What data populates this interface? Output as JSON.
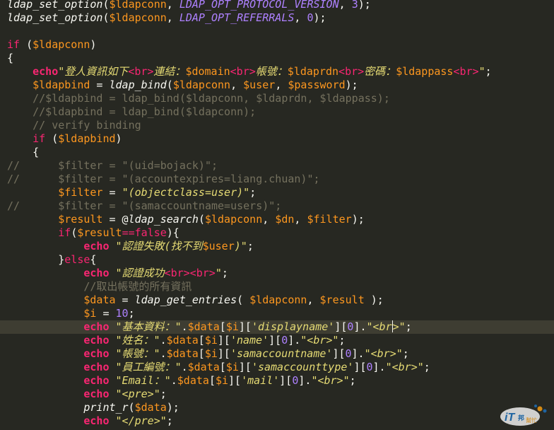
{
  "editor": {
    "highlight_line": 24,
    "cursor_line": 24,
    "lines": [
      [
        [
          "fn",
          "ldap_set_option"
        ],
        [
          "plain",
          "("
        ],
        [
          "var",
          "$ldapconn"
        ],
        [
          "plain",
          ", "
        ],
        [
          "const",
          "LDAP_OPT_PROTOCOL_VERSION"
        ],
        [
          "plain",
          ", "
        ],
        [
          "num",
          "3"
        ],
        [
          "plain",
          ");"
        ]
      ],
      [
        [
          "fn",
          "ldap_set_option"
        ],
        [
          "plain",
          "("
        ],
        [
          "var",
          "$ldapconn"
        ],
        [
          "plain",
          ", "
        ],
        [
          "const",
          "LDAP_OPT_REFERRALS"
        ],
        [
          "plain",
          ", "
        ],
        [
          "num",
          "0"
        ],
        [
          "plain",
          ");"
        ]
      ],
      [],
      [
        [
          "kw",
          "if"
        ],
        [
          "plain",
          " ("
        ],
        [
          "var",
          "$ldapconn"
        ],
        [
          "plain",
          ")"
        ]
      ],
      [
        [
          "plain",
          "{"
        ]
      ],
      [
        [
          "plain",
          "    "
        ],
        [
          "echo",
          "echo"
        ],
        [
          "str",
          "\"登人資訊如下"
        ],
        [
          "tag",
          "<br>"
        ],
        [
          "str",
          "連結："
        ],
        [
          "var",
          "$domain"
        ],
        [
          "tag",
          "<br>"
        ],
        [
          "str",
          "帳號："
        ],
        [
          "var",
          "$ldaprdn"
        ],
        [
          "tag",
          "<br>"
        ],
        [
          "str",
          "密碼："
        ],
        [
          "var",
          "$ldappass"
        ],
        [
          "tag",
          "<br>"
        ],
        [
          "str",
          "\""
        ],
        [
          "plain",
          ";"
        ]
      ],
      [
        [
          "plain",
          "    "
        ],
        [
          "var",
          "$ldapbind"
        ],
        [
          "plain",
          " = "
        ],
        [
          "fn",
          "ldap_bind"
        ],
        [
          "plain",
          "("
        ],
        [
          "var",
          "$ldapconn"
        ],
        [
          "plain",
          ", "
        ],
        [
          "var",
          "$user"
        ],
        [
          "plain",
          ", "
        ],
        [
          "var",
          "$password"
        ],
        [
          "plain",
          ");"
        ]
      ],
      [
        [
          "cmt",
          "    //$ldapbind = ldap_bind($ldapconn, $ldaprdn, $ldappass);"
        ]
      ],
      [
        [
          "cmt",
          "    //$ldapbind = ldap_bind($ldapconn);"
        ]
      ],
      [
        [
          "cmt",
          "    // verify binding"
        ]
      ],
      [
        [
          "plain",
          "    "
        ],
        [
          "kw",
          "if"
        ],
        [
          "plain",
          " ("
        ],
        [
          "var",
          "$ldapbind"
        ],
        [
          "plain",
          ")"
        ]
      ],
      [
        [
          "plain",
          "    {"
        ]
      ],
      [
        [
          "cmt",
          "//      $filter = \"(uid=bojack)\";"
        ]
      ],
      [
        [
          "cmt",
          "//      $filter = \"(accountexpires=liang.chuan)\";"
        ]
      ],
      [
        [
          "plain",
          "        "
        ],
        [
          "var",
          "$filter"
        ],
        [
          "plain",
          " = "
        ],
        [
          "str",
          "\"(objectclass=user)\""
        ],
        [
          "plain",
          ";"
        ]
      ],
      [
        [
          "cmt",
          "//      $filter = \"(samaccountname=users)\";"
        ]
      ],
      [
        [
          "plain",
          "        "
        ],
        [
          "var",
          "$result"
        ],
        [
          "plain",
          " = @"
        ],
        [
          "fn",
          "ldap_search"
        ],
        [
          "plain",
          "("
        ],
        [
          "var",
          "$ldapconn"
        ],
        [
          "plain",
          ", "
        ],
        [
          "var",
          "$dn"
        ],
        [
          "plain",
          ", "
        ],
        [
          "var",
          "$filter"
        ],
        [
          "plain",
          ");"
        ]
      ],
      [
        [
          "plain",
          "        "
        ],
        [
          "kw",
          "if"
        ],
        [
          "plain",
          "("
        ],
        [
          "var",
          "$result"
        ],
        [
          "kw",
          "=="
        ],
        [
          "kw",
          "false"
        ],
        [
          "plain",
          "){"
        ]
      ],
      [
        [
          "plain",
          "            "
        ],
        [
          "echo",
          "echo"
        ],
        [
          "plain",
          " "
        ],
        [
          "str",
          "\"認證失敗(找不到"
        ],
        [
          "var",
          "$user"
        ],
        [
          "str",
          ")\""
        ],
        [
          "plain",
          ";"
        ]
      ],
      [
        [
          "plain",
          "        }"
        ],
        [
          "kw",
          "else"
        ],
        [
          "plain",
          "{"
        ]
      ],
      [
        [
          "plain",
          "            "
        ],
        [
          "echo",
          "echo"
        ],
        [
          "plain",
          " "
        ],
        [
          "str",
          "\"認證成功"
        ],
        [
          "tag",
          "<br><br>"
        ],
        [
          "str",
          "\""
        ],
        [
          "plain",
          ";"
        ]
      ],
      [
        [
          "cmt",
          "            //取出帳號的所有資訊"
        ]
      ],
      [
        [
          "plain",
          "            "
        ],
        [
          "var",
          "$data"
        ],
        [
          "plain",
          " = "
        ],
        [
          "fn",
          "ldap_get_entries"
        ],
        [
          "plain",
          "( "
        ],
        [
          "var",
          "$ldapconn"
        ],
        [
          "plain",
          ", "
        ],
        [
          "var",
          "$result"
        ],
        [
          "plain",
          " );"
        ]
      ],
      [
        [
          "plain",
          "            "
        ],
        [
          "var",
          "$i"
        ],
        [
          "plain",
          " = "
        ],
        [
          "num",
          "10"
        ],
        [
          "plain",
          ";"
        ]
      ],
      [
        [
          "plain",
          "            "
        ],
        [
          "echo",
          "echo"
        ],
        [
          "plain",
          " "
        ],
        [
          "str",
          "\"基本資料：\""
        ],
        [
          "plain",
          "."
        ],
        [
          "var",
          "$data"
        ],
        [
          "plain",
          "["
        ],
        [
          "var",
          "$i"
        ],
        [
          "plain",
          "]["
        ],
        [
          "str",
          "'displayname'"
        ],
        [
          "plain",
          "]["
        ],
        [
          "num",
          "0"
        ],
        [
          "plain",
          "]."
        ],
        [
          "str",
          "\"<br"
        ],
        [
          "cursor",
          ""
        ],
        [
          "str",
          ">\""
        ],
        [
          "plain",
          ";"
        ]
      ],
      [
        [
          "plain",
          "            "
        ],
        [
          "echo",
          "echo"
        ],
        [
          "plain",
          " "
        ],
        [
          "str",
          "\"姓名：\""
        ],
        [
          "plain",
          "."
        ],
        [
          "var",
          "$data"
        ],
        [
          "plain",
          "["
        ],
        [
          "var",
          "$i"
        ],
        [
          "plain",
          "]["
        ],
        [
          "str",
          "'name'"
        ],
        [
          "plain",
          "]["
        ],
        [
          "num",
          "0"
        ],
        [
          "plain",
          "]."
        ],
        [
          "str",
          "\"<br>\""
        ],
        [
          "plain",
          ";"
        ]
      ],
      [
        [
          "plain",
          "            "
        ],
        [
          "echo",
          "echo"
        ],
        [
          "plain",
          " "
        ],
        [
          "str",
          "\"帳號：\""
        ],
        [
          "plain",
          "."
        ],
        [
          "var",
          "$data"
        ],
        [
          "plain",
          "["
        ],
        [
          "var",
          "$i"
        ],
        [
          "plain",
          "]["
        ],
        [
          "str",
          "'samaccountname'"
        ],
        [
          "plain",
          "]["
        ],
        [
          "num",
          "0"
        ],
        [
          "plain",
          "]."
        ],
        [
          "str",
          "\"<br>\""
        ],
        [
          "plain",
          ";"
        ]
      ],
      [
        [
          "plain",
          "            "
        ],
        [
          "echo",
          "echo"
        ],
        [
          "plain",
          " "
        ],
        [
          "str",
          "\"員工編號：\""
        ],
        [
          "plain",
          "."
        ],
        [
          "var",
          "$data"
        ],
        [
          "plain",
          "["
        ],
        [
          "var",
          "$i"
        ],
        [
          "plain",
          "]["
        ],
        [
          "str",
          "'samaccounttype'"
        ],
        [
          "plain",
          "]["
        ],
        [
          "num",
          "0"
        ],
        [
          "plain",
          "]."
        ],
        [
          "str",
          "\"<br>\""
        ],
        [
          "plain",
          ";"
        ]
      ],
      [
        [
          "plain",
          "            "
        ],
        [
          "echo",
          "echo"
        ],
        [
          "plain",
          " "
        ],
        [
          "str",
          "\"Email：\""
        ],
        [
          "plain",
          "."
        ],
        [
          "var",
          "$data"
        ],
        [
          "plain",
          "["
        ],
        [
          "var",
          "$i"
        ],
        [
          "plain",
          "]["
        ],
        [
          "str",
          "'mail'"
        ],
        [
          "plain",
          "]["
        ],
        [
          "num",
          "0"
        ],
        [
          "plain",
          "]."
        ],
        [
          "str",
          "\"<br>\""
        ],
        [
          "plain",
          ";"
        ]
      ],
      [
        [
          "plain",
          "            "
        ],
        [
          "echo",
          "echo"
        ],
        [
          "plain",
          " "
        ],
        [
          "str",
          "\"<pre>\""
        ],
        [
          "plain",
          ";"
        ]
      ],
      [
        [
          "plain",
          "            "
        ],
        [
          "fn",
          "print_r"
        ],
        [
          "plain",
          "("
        ],
        [
          "var",
          "$data"
        ],
        [
          "plain",
          ");"
        ]
      ],
      [
        [
          "plain",
          "            "
        ],
        [
          "echo",
          "echo"
        ],
        [
          "plain",
          " "
        ],
        [
          "str",
          "\"</pre>\""
        ],
        [
          "plain",
          ";"
        ]
      ]
    ]
  },
  "watermark": {
    "text": "iT邦幫忙",
    "logo_text": "iT",
    "sub_text": "幫忙",
    "color_primary": "#1d6fb8",
    "color_accent": "#f39c12"
  }
}
